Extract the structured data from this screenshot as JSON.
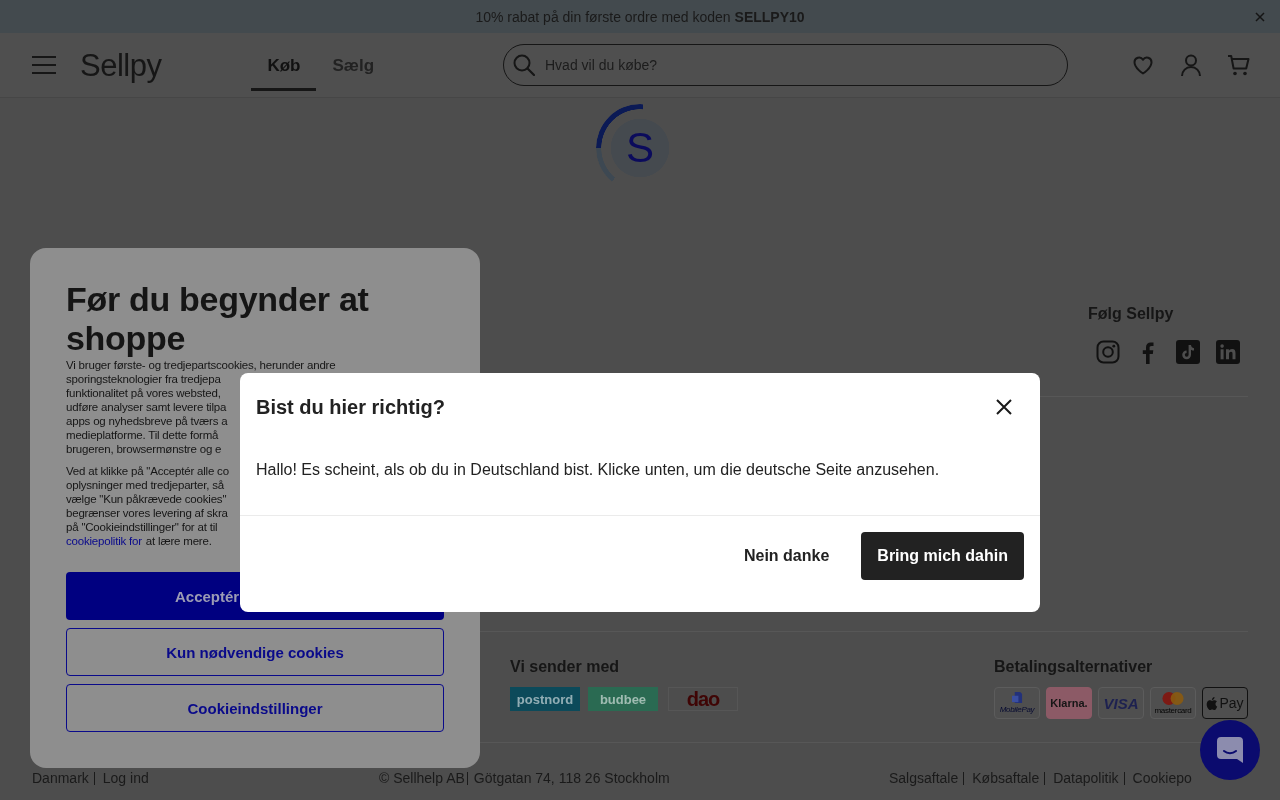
{
  "promo_bar": {
    "text": "10% rabat på din første ordre med koden **SELLPY10**"
  },
  "header": {
    "logo": "Sellpy",
    "tabs": [
      {
        "label": "Køb",
        "selected": true
      },
      {
        "label": "Sælg",
        "selected": false
      }
    ],
    "search": {
      "placeholder": "Hvad vil du købe?"
    }
  },
  "loader": {
    "letter": "S"
  },
  "footer": {
    "follow_title": "Følg Sellpy",
    "shipping": {
      "title": "Vi sender med",
      "carriers": [
        {
          "kind": "filled",
          "name": "postnord",
          "color": "#0c4a5a"
        },
        {
          "kind": "filled",
          "name": "budbee",
          "color": "#2a6a52"
        },
        {
          "kind": "outline",
          "name": "dao",
          "color": "#3f0505"
        }
      ]
    },
    "payments": {
      "title": "Betalingsalternativer",
      "methods": [
        {
          "kind": "mobilepay",
          "label": "MobilePay"
        },
        {
          "kind": "klarna",
          "label": "Klarna."
        },
        {
          "kind": "visa",
          "label": "VISA"
        },
        {
          "kind": "mastercard",
          "label": "mastercard"
        },
        {
          "kind": "applepay",
          "label": "Pay"
        }
      ]
    },
    "bottom_bar": {
      "left_links": [
        "Danmark",
        "Log ind"
      ],
      "company": [
        "© Sellhelp AB",
        "Götgatan 74, 118 26 Stockholm"
      ],
      "legal_links": [
        "Salgsaftale",
        "Købsaftale",
        "Datapolitik",
        "Cookiepo"
      ]
    }
  },
  "cookie_panel": {
    "title": "Før du begynder at shoppe",
    "paragraphs": [
      {
        "lines": [
          "Vi bruger første- og tredjepartscookies, herunder andre",
          "sporingsteknologier fra tredjepa",
          "funktionalitet på vores websted,",
          "udføre analyser samt levere tilpa",
          "apps og nyhedsbreve på tværs a",
          "medieplatforme. Til dette formå",
          "brugeren, browsermønstre og e"
        ]
      },
      {
        "lines": [
          "Ved at klikke på \"Acceptér alle co",
          "oplysninger med tredjeparter, så",
          "vælge \"Kun påkrævede cookies\"",
          "begrænser vores levering af skra",
          "på \"Cookieindstillinger\" for at til"
        ],
        "link": "cookiepolitik for",
        "link_after": "at lære mere."
      }
    ],
    "buttons": [
      {
        "kind": "primary",
        "label": "Acceptér"
      },
      {
        "kind": "outline",
        "label": "Kun nødvendige cookies"
      },
      {
        "kind": "outline",
        "label": "Cookieindstillinger"
      }
    ]
  },
  "location_dialog": {
    "title": "Bist du hier richtig?",
    "message": "Hallo! Es scheint, als ob du in Deutschland bist. Klicke unten, um die deutsche Seite anzusehen.",
    "buttons": [
      {
        "kind": "text",
        "label": "Nein danke"
      },
      {
        "kind": "primary",
        "label": "Bring mich dahin"
      }
    ]
  }
}
